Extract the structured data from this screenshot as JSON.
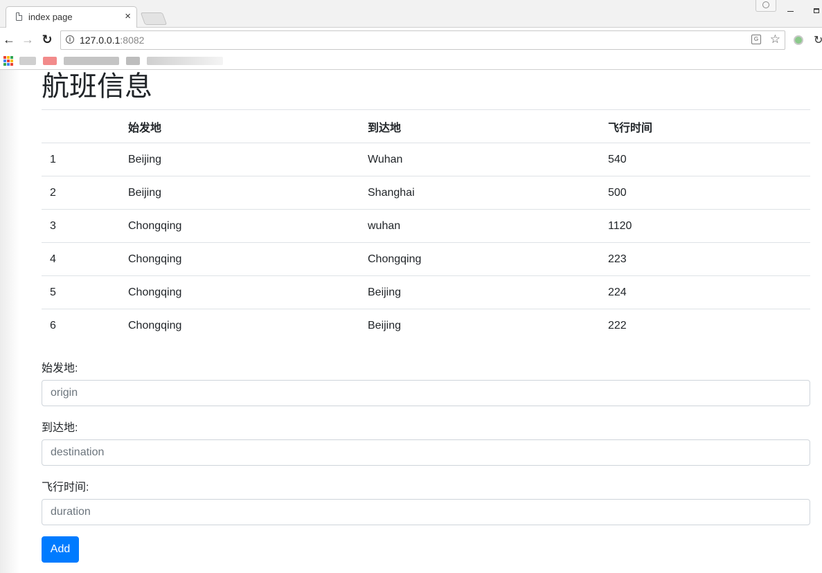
{
  "browser": {
    "tab_title": "index page",
    "tab_close": "×",
    "url_host": "127.0.0.1",
    "url_port": ":8082",
    "back": "←",
    "forward": "→",
    "reload": "↻",
    "star": "☆",
    "translate": "G",
    "info": "i",
    "ext_refresh": "↻"
  },
  "page": {
    "title": "航班信息",
    "table": {
      "headers": [
        "",
        "始发地",
        "到达地",
        "飞行时间"
      ],
      "rows": [
        [
          "1",
          "Beijing",
          "Wuhan",
          "540"
        ],
        [
          "2",
          "Beijing",
          "Shanghai",
          "500"
        ],
        [
          "3",
          "Chongqing",
          "wuhan",
          "1120"
        ],
        [
          "4",
          "Chongqing",
          "Chongqing",
          "223"
        ],
        [
          "5",
          "Chongqing",
          "Beijing",
          "224"
        ],
        [
          "6",
          "Chongqing",
          "Beijing",
          "222"
        ]
      ]
    },
    "form": {
      "origin_label": "始发地:",
      "origin_placeholder": "origin",
      "destination_label": "到达地:",
      "destination_placeholder": "destination",
      "duration_label": "飞行时间:",
      "duration_placeholder": "duration",
      "submit_label": "Add",
      "submit_color": "#007bff"
    }
  }
}
